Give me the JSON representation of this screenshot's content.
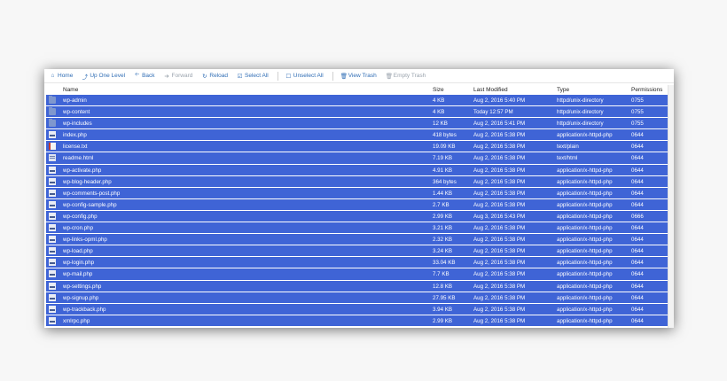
{
  "toolbar": {
    "home": "Home",
    "up": "Up One Level",
    "back": "Back",
    "forward": "Forward",
    "reload": "Reload",
    "select_all": "Select All",
    "unselect_all": "Unselect All",
    "view_trash": "View Trash",
    "empty_trash": "Empty Trash"
  },
  "columns": {
    "name": "Name",
    "size": "Size",
    "modified": "Last Modified",
    "type": "Type",
    "permissions": "Permissions"
  },
  "files": [
    {
      "icon": "folder-icon",
      "name": "wp-admin",
      "size": "4 KB",
      "modified": "Aug 2, 2016 5:40 PM",
      "type": "httpd/unix-directory",
      "perm": "0755"
    },
    {
      "icon": "folder-icon",
      "name": "wp-content",
      "size": "4 KB",
      "modified": "Today 12:57 PM",
      "type": "httpd/unix-directory",
      "perm": "0755"
    },
    {
      "icon": "folder-icon",
      "name": "wp-includes",
      "size": "12 KB",
      "modified": "Aug 2, 2016 5:41 PM",
      "type": "httpd/unix-directory",
      "perm": "0755"
    },
    {
      "icon": "php-file-icon",
      "name": "index.php",
      "size": "418 bytes",
      "modified": "Aug 2, 2016 5:38 PM",
      "type": "application/x-httpd-php",
      "perm": "0644"
    },
    {
      "icon": "text-file-icon",
      "name": "license.txt",
      "size": "19.09 KB",
      "modified": "Aug 2, 2016 5:38 PM",
      "type": "text/plain",
      "perm": "0644"
    },
    {
      "icon": "html-file-icon",
      "name": "readme.html",
      "size": "7.19 KB",
      "modified": "Aug 2, 2016 5:38 PM",
      "type": "text/html",
      "perm": "0644"
    },
    {
      "icon": "php-file-icon",
      "name": "wp-activate.php",
      "size": "4.91 KB",
      "modified": "Aug 2, 2016 5:38 PM",
      "type": "application/x-httpd-php",
      "perm": "0644"
    },
    {
      "icon": "php-file-icon",
      "name": "wp-blog-header.php",
      "size": "364 bytes",
      "modified": "Aug 2, 2016 5:38 PM",
      "type": "application/x-httpd-php",
      "perm": "0644"
    },
    {
      "icon": "php-file-icon",
      "name": "wp-comments-post.php",
      "size": "1.44 KB",
      "modified": "Aug 2, 2016 5:38 PM",
      "type": "application/x-httpd-php",
      "perm": "0644"
    },
    {
      "icon": "php-file-icon",
      "name": "wp-config-sample.php",
      "size": "2.7 KB",
      "modified": "Aug 2, 2016 5:38 PM",
      "type": "application/x-httpd-php",
      "perm": "0644"
    },
    {
      "icon": "php-file-icon",
      "name": "wp-config.php",
      "size": "2.99 KB",
      "modified": "Aug 3, 2016 5:43 PM",
      "type": "application/x-httpd-php",
      "perm": "0666"
    },
    {
      "icon": "php-file-icon",
      "name": "wp-cron.php",
      "size": "3.21 KB",
      "modified": "Aug 2, 2016 5:38 PM",
      "type": "application/x-httpd-php",
      "perm": "0644"
    },
    {
      "icon": "php-file-icon",
      "name": "wp-links-opml.php",
      "size": "2.32 KB",
      "modified": "Aug 2, 2016 5:38 PM",
      "type": "application/x-httpd-php",
      "perm": "0644"
    },
    {
      "icon": "php-file-icon",
      "name": "wp-load.php",
      "size": "3.24 KB",
      "modified": "Aug 2, 2016 5:38 PM",
      "type": "application/x-httpd-php",
      "perm": "0644"
    },
    {
      "icon": "php-file-icon",
      "name": "wp-login.php",
      "size": "33.04 KB",
      "modified": "Aug 2, 2016 5:38 PM",
      "type": "application/x-httpd-php",
      "perm": "0644"
    },
    {
      "icon": "php-file-icon",
      "name": "wp-mail.php",
      "size": "7.7 KB",
      "modified": "Aug 2, 2016 5:38 PM",
      "type": "application/x-httpd-php",
      "perm": "0644"
    },
    {
      "icon": "php-file-icon",
      "name": "wp-settings.php",
      "size": "12.8 KB",
      "modified": "Aug 2, 2016 5:38 PM",
      "type": "application/x-httpd-php",
      "perm": "0644"
    },
    {
      "icon": "php-file-icon",
      "name": "wp-signup.php",
      "size": "27.95 KB",
      "modified": "Aug 2, 2016 5:38 PM",
      "type": "application/x-httpd-php",
      "perm": "0644"
    },
    {
      "icon": "php-file-icon",
      "name": "wp-trackback.php",
      "size": "3.94 KB",
      "modified": "Aug 2, 2016 5:38 PM",
      "type": "application/x-httpd-php",
      "perm": "0644"
    },
    {
      "icon": "php-file-icon",
      "name": "xmlrpc.php",
      "size": "2.99 KB",
      "modified": "Aug 2, 2016 5:38 PM",
      "type": "application/x-httpd-php",
      "perm": "0644"
    }
  ],
  "colors": {
    "selected_row": "#3f64d6",
    "toolbar_link": "#2f6db5"
  }
}
